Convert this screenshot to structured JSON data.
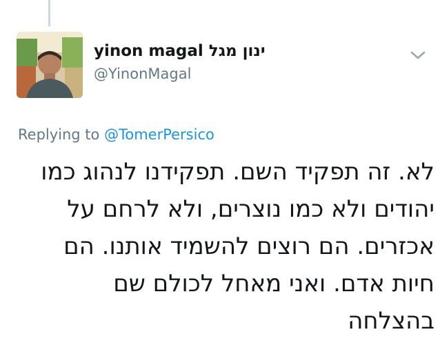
{
  "author": {
    "display_name": "yinon magal ינון מגל",
    "handle": "@YinonMagal"
  },
  "reply_context": {
    "prefix": "Replying to",
    "mention": "@TomerPersico"
  },
  "tweet": {
    "lines": [
      "לא. זה תפקיד השם. תפקידנו לנהוג כמו",
      "יהודים ולא כמו נוצרים, ולא לרחם על",
      "אכזרים. הם רוצים להשמיד אותנו. הם",
      "חיות אדם. ואני מאחל לכולם שם",
      "בהצלחה"
    ]
  },
  "icons": {
    "menu": "chevron-down-icon",
    "avatar": "profile-photo"
  },
  "colors": {
    "mention": "#1b95e0",
    "secondary_text": "#657786",
    "primary_text": "#14171a",
    "thread_line": "#ccd6dd"
  }
}
